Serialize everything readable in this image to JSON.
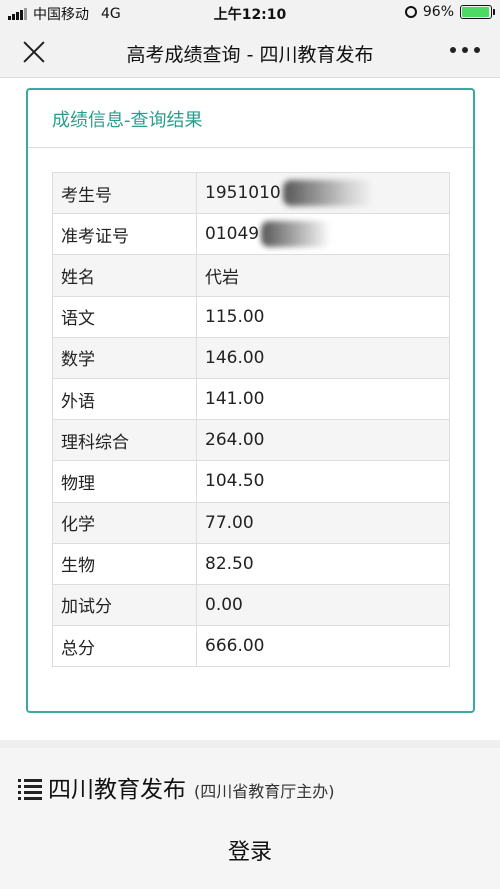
{
  "status_bar": {
    "carrier": "中国移动",
    "network": "4G",
    "time": "上午12:10",
    "battery_percent": "96%",
    "battery_level": 0.96
  },
  "nav": {
    "title": "高考成绩查询 - 四川教育发布",
    "close_icon": "close-icon",
    "more_icon": "more-icon"
  },
  "panel": {
    "heading": "成绩信息-查询结果"
  },
  "table": {
    "rows": [
      {
        "label": "考生号",
        "value": "1951010"
      },
      {
        "label": "准考证号",
        "value": "01049"
      },
      {
        "label": "姓名",
        "value": "代岩"
      },
      {
        "label": "语文",
        "value": "115.00"
      },
      {
        "label": "数学",
        "value": "146.00"
      },
      {
        "label": "外语",
        "value": "141.00"
      },
      {
        "label": "理科综合",
        "value": "264.00"
      },
      {
        "label": "物理",
        "value": "104.50"
      },
      {
        "label": "化学",
        "value": "77.00"
      },
      {
        "label": "生物",
        "value": "82.50"
      },
      {
        "label": "加试分",
        "value": "0.00"
      },
      {
        "label": "总分",
        "value": "666.00"
      }
    ]
  },
  "footer": {
    "menu_icon": "menu-icon",
    "brand": "四川教育发布",
    "brand_sub": "(四川省教育厅主办)",
    "login": "登录"
  },
  "colors": {
    "accent": "#3aa99f",
    "heading_text": "#2a9d8f",
    "battery": "#4cd964"
  }
}
